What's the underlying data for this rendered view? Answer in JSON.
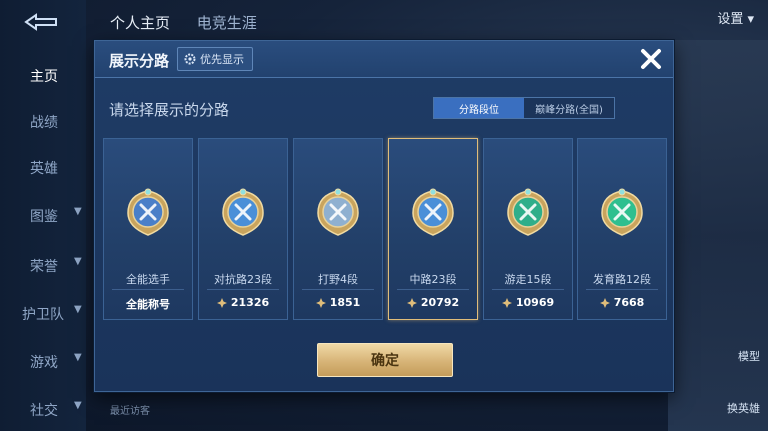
{
  "background": {
    "top_tabs": [
      "个人主页",
      "电竞生涯"
    ],
    "settings_label": "设置",
    "nav_items": [
      "主页",
      "战绩",
      "英雄",
      "图鉴",
      "荣誉",
      "护卫队",
      "游戏",
      "社交"
    ],
    "right_labels": [
      "模型",
      "换英雄"
    ],
    "recent_visitors": "最近访客"
  },
  "modal": {
    "title": "展示分路",
    "pref_button": "优先显示",
    "subtitle": "请选择展示的分路",
    "toggle": [
      "分路段位",
      "巅峰分路(全国)"
    ],
    "cards": [
      {
        "name": "全能选手",
        "score": "全能称号",
        "emblem": "all-round-icon",
        "color": "#4a7fc8"
      },
      {
        "name": "对抗路23段",
        "score": "21326",
        "emblem": "clash-lane-icon",
        "color": "#4a8fd8"
      },
      {
        "name": "打野4段",
        "score": "1851",
        "emblem": "jungle-icon",
        "color": "#8fb0d0"
      },
      {
        "name": "中路23段",
        "score": "20792",
        "emblem": "mid-lane-icon",
        "color": "#4a8fd8"
      },
      {
        "name": "游走15段",
        "score": "10969",
        "emblem": "roam-icon",
        "color": "#2fae8a"
      },
      {
        "name": "发育路12段",
        "score": "7668",
        "emblem": "farm-lane-icon",
        "color": "#2fbf8f"
      }
    ],
    "selected_index": 3,
    "confirm_label": "确定"
  },
  "colors": {
    "gold": "#e0bd7a",
    "toggle_active": "#3a6fc0"
  }
}
